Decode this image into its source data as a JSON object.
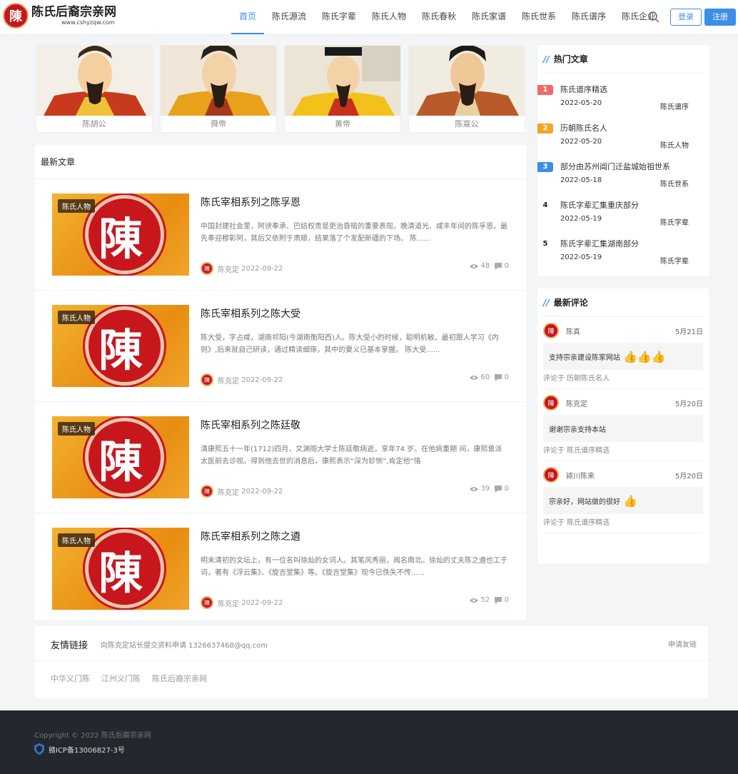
{
  "header": {
    "logo_title": "陈氏后裔宗亲网",
    "logo_url": "www.cshyzqw.com",
    "logo_seal": "陳",
    "nav": [
      "首页",
      "陈氏源流",
      "陈氏字辈",
      "陈氏人物",
      "陈氏春秋",
      "陈氏家谱",
      "陈氏世系",
      "陈氏谱序",
      "陈氏企业"
    ],
    "login_label": "登录",
    "register_label": "注册"
  },
  "cards": [
    {
      "name": "陈胡公"
    },
    {
      "name": "舜帝"
    },
    {
      "name": "黄帝"
    },
    {
      "name": "陈寔公"
    }
  ],
  "latest": {
    "title": "最新文章",
    "articles": [
      {
        "tag": "陈氏人物",
        "title": "陈氏宰相系列之陈孚恩",
        "summary": "中国封建社会里，阿谀奉承、巴结权贵是吏治昏暗的重要表现。晚清道光、咸丰年间的陈孚恩，最先奉迎穆彰阿，其后又依附于肃顺，结果落了个发配新疆的下场。 陈......",
        "author": "陈克定",
        "date": "2022-09-22",
        "views": "48",
        "comments": "0"
      },
      {
        "tag": "陈氏人物",
        "title": "陈氏宰相系列之陈大受",
        "summary": "陈大受，字占咸，湖南祁阳(今湖南衡阳西)人。陈大受小的时候，聪明机敏。最初跟人学习《内则》,后来就自己研读，通过精读细琢，其中的要义已基本掌握。 陈大受......",
        "author": "陈克定",
        "date": "2022-09-22",
        "views": "60",
        "comments": "0"
      },
      {
        "tag": "陈氏人物",
        "title": "陈氏宰相系列之陈廷敬",
        "summary": "清康熙五十一年(1712)四月，文渊阁大学士陈廷敬病逝，享年74 岁。在他病重期 间，康熙曾派太医前去诊视。得到他去世的消息后，康熙表示“深为轸恻”,肯定他“恪",
        "author": "陈克定",
        "date": "2022-09-22",
        "views": "39",
        "comments": "0"
      },
      {
        "tag": "陈氏人物",
        "title": "陈氏宰相系列之陈之遴",
        "summary": "明末清初的文坛上，有一位名叫徐灿的女词人。其笔风秀丽，闻名南北。徐灿的丈夫陈之遴也工于词，著有《浮云集》、《旋吉堂集》等。《旋吉堂集》现今已佚失不传......",
        "author": "陈克定",
        "date": "2022-09-22",
        "views": "52",
        "comments": "0"
      }
    ]
  },
  "hot": {
    "title": "热门文章",
    "items": [
      {
        "rank": "1",
        "title": "陈氏谱序精选",
        "date": "2022-05-20",
        "category": "陈氏谱序",
        "color": "#f0686a"
      },
      {
        "rank": "2",
        "title": "历朝陈氏名人",
        "date": "2022-05-20",
        "category": "陈氏人物",
        "color": "#f5a524"
      },
      {
        "rank": "3",
        "title": "部分由苏州阊门迁盐城始祖世系",
        "date": "2022-05-18",
        "category": "陈氏世系",
        "color": "#3b8fe8"
      },
      {
        "rank": "4",
        "title": "陈氏字辈汇集重庆部分",
        "date": "2022-05-19",
        "category": "陈氏字辈",
        "color": ""
      },
      {
        "rank": "5",
        "title": "陈氏字辈汇集湖南部分",
        "date": "2022-05-19",
        "category": "陈氏字辈",
        "color": ""
      }
    ]
  },
  "comments": {
    "title": "最新评论",
    "items": [
      {
        "user": "陈真",
        "date": "5月21日",
        "text": "支持宗亲建设陈家网站",
        "thumbs": "👍👍👍",
        "on": "评论于 历朝陈氏名人"
      },
      {
        "user": "陈克定",
        "date": "5月20日",
        "text": "谢谢宗亲支持本站",
        "thumbs": "",
        "on": "评论于 陈氏谱序精选"
      },
      {
        "user": "颍川陈来",
        "date": "5月20日",
        "text": "宗亲好，网站做的很好",
        "thumbs": "👍",
        "on": "评论于 陈氏谱序精选"
      }
    ]
  },
  "links": {
    "title": "友情链接",
    "subtitle": "向陈克定站长提交资料申请 1326637468@qq.com",
    "apply": "申请友链",
    "items": [
      "中华义门陈",
      "江州义门陈",
      "陈氏后裔宗亲网"
    ]
  },
  "footer": {
    "copyright": "Copyright © 2022 陈氏后裔宗亲网",
    "icp": "赣ICP备13006827-3号"
  }
}
